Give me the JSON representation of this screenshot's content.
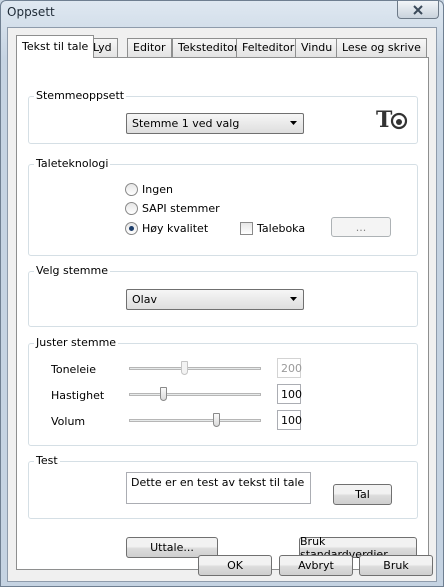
{
  "window": {
    "title": "Oppsett"
  },
  "tabs": [
    "Tekst til tale",
    "Lyd",
    "Editor",
    "Teksteditor",
    "Felteditor",
    "Vindu",
    "Lese og skrive"
  ],
  "stemmeoppsett": {
    "label": "Stemmeoppsett",
    "combo_value": "Stemme 1 ved valg",
    "logo_text": "T"
  },
  "taleteknologi": {
    "label": "Taleteknologi",
    "options": [
      "Ingen",
      "SAPI stemmer",
      "Høy kvalitet"
    ],
    "selected": "Høy kvalitet",
    "taleboka_label": "Taleboka",
    "taleboka_checked": false,
    "browse_label": "..."
  },
  "velg_stemme": {
    "label": "Velg stemme",
    "combo_value": "Olav"
  },
  "juster_stemme": {
    "label": "Juster stemme",
    "sliders": [
      {
        "label": "Toneleie",
        "value": "200",
        "level": 0.42,
        "enabled": false
      },
      {
        "label": "Hastighet",
        "value": "100",
        "level": 0.26,
        "enabled": true
      },
      {
        "label": "Volum",
        "value": "100",
        "level": 0.66,
        "enabled": true
      }
    ]
  },
  "test": {
    "label": "Test",
    "text": "Dette er en test av tekst til tale",
    "speak_button": "Tal"
  },
  "page_buttons": {
    "uttale": "Uttale...",
    "standard": "Bruk standardverdier"
  },
  "dialog_buttons": {
    "ok": "OK",
    "cancel": "Avbryt",
    "apply": "Bruk"
  }
}
